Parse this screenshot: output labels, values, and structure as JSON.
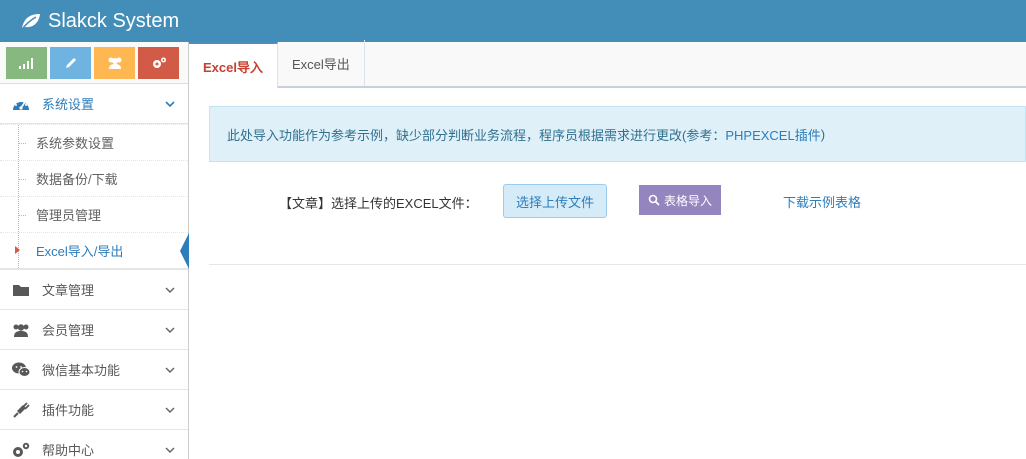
{
  "header": {
    "brand": "Slakck System"
  },
  "sidebar": {
    "groups": [
      {
        "label": "系统设置",
        "expanded": true,
        "items": [
          {
            "label": "系统参数设置"
          },
          {
            "label": "数据备份/下载"
          },
          {
            "label": "管理员管理"
          },
          {
            "label": "Excel导入/导出"
          }
        ]
      }
    ],
    "menus": [
      {
        "label": "文章管理"
      },
      {
        "label": "会员管理"
      },
      {
        "label": "微信基本功能"
      },
      {
        "label": "插件功能"
      },
      {
        "label": "帮助中心"
      }
    ]
  },
  "tabs": [
    {
      "label": "Excel导入"
    },
    {
      "label": "Excel导出"
    }
  ],
  "alert": {
    "text": "此处导入功能作为参考示例，缺少部分判断业务流程，程序员根据需求进行更改(参考：",
    "link": "PHPEXCEL插件",
    "suffix": ")"
  },
  "form": {
    "label": "【文章】选择上传的EXCEL文件：",
    "upload_button": "选择上传文件",
    "import_button": "表格导入",
    "download_link": "下载示例表格"
  },
  "colors": {
    "header": "#438eb9",
    "accent": "#2b7dbc",
    "active_tab": "#c7402f",
    "import_button": "#9585bf"
  }
}
